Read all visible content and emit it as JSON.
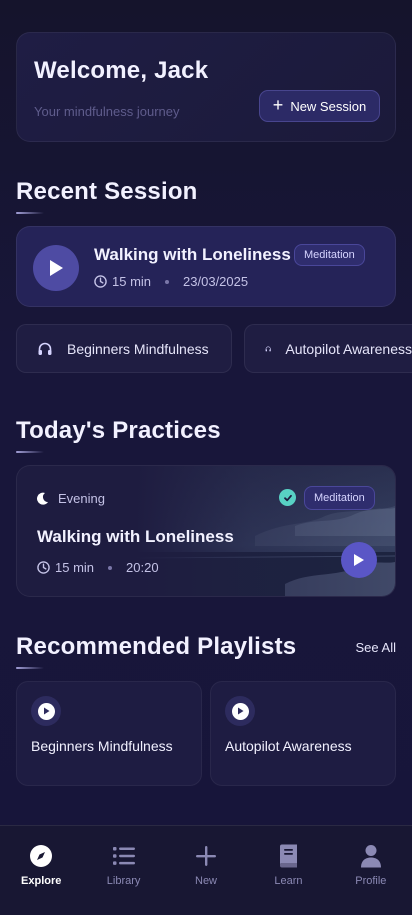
{
  "welcome": {
    "title": "Welcome, Jack",
    "subtitle": "Your mindfulness journey",
    "new_session_label": "New Session"
  },
  "recent_session": {
    "section_title": "Recent Session",
    "title": "Walking with Loneliness",
    "tag": "Meditation",
    "duration": "15 min",
    "date": "23/03/2025"
  },
  "chips": [
    {
      "label": "Beginners Mindfulness",
      "icon": "headphones-icon"
    },
    {
      "label": "Autopilot Awareness",
      "icon": "headphones-icon"
    }
  ],
  "todays_practices": {
    "section_title": "Today's Practices",
    "time_of_day": "Evening",
    "tag": "Meditation",
    "title": "Walking with Loneliness",
    "duration": "15 min",
    "time": "20:20",
    "completed": true
  },
  "recommended": {
    "section_title": "Recommended Playlists",
    "see_all": "See All",
    "playlists": [
      {
        "title": "Beginners Mindfulness"
      },
      {
        "title": "Autopilot Awareness"
      }
    ]
  },
  "nav": {
    "items": [
      {
        "label": "Explore",
        "icon": "compass-icon",
        "active": true
      },
      {
        "label": "Library",
        "icon": "list-icon",
        "active": false
      },
      {
        "label": "New",
        "icon": "plus-icon",
        "active": false
      },
      {
        "label": "Learn",
        "icon": "book-icon",
        "active": false
      },
      {
        "label": "Profile",
        "icon": "person-icon",
        "active": false
      }
    ]
  },
  "colors": {
    "background": "#17153a",
    "accent": "#5a56c6",
    "success": "#58d1c4"
  }
}
